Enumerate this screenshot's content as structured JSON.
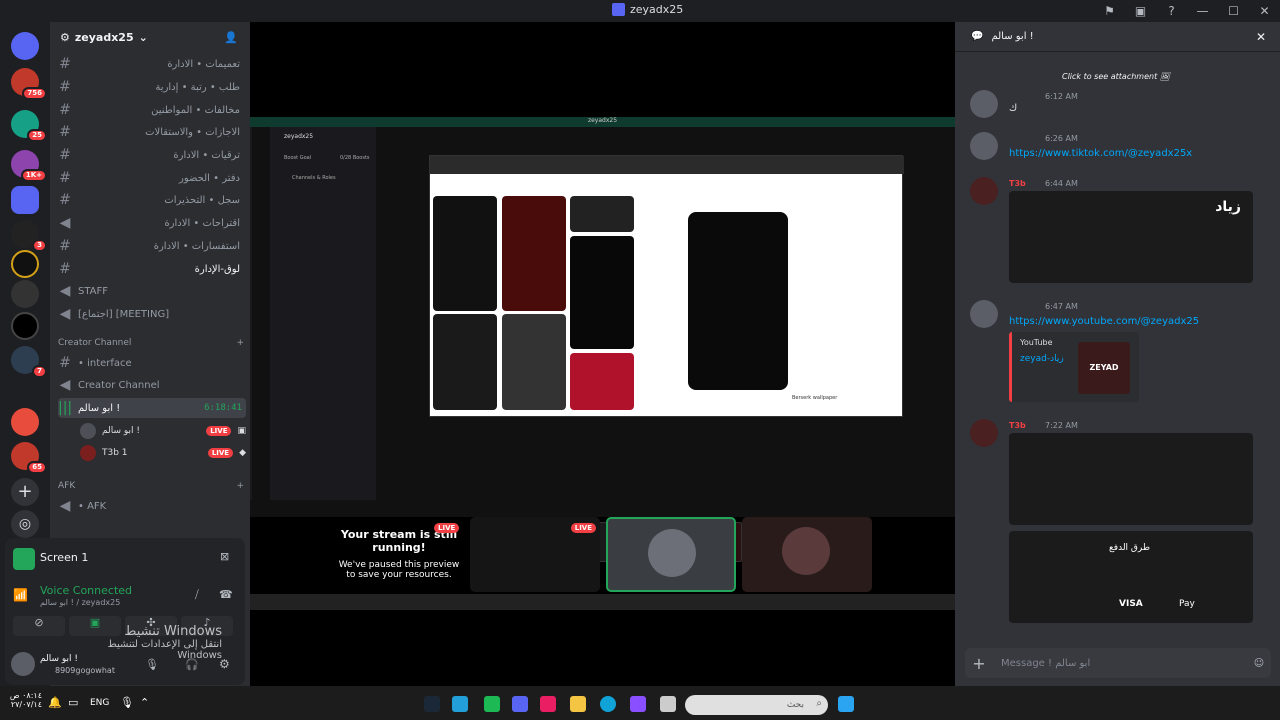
{
  "window": {
    "title": "zeyadx25"
  },
  "rail": {
    "badges": [
      "756",
      "25",
      "1K+",
      "3",
      "7",
      "65"
    ]
  },
  "guild": {
    "name": "zeyadx25"
  },
  "channels": [
    {
      "label": "تعميمات • الادارة",
      "icon": "hash"
    },
    {
      "label": "طلب • رتبة • إدارية",
      "icon": "hash"
    },
    {
      "label": "مخالفات • المواطنين",
      "icon": "hash"
    },
    {
      "label": "الاجازات • والاستقالات",
      "icon": "hash"
    },
    {
      "label": "ترقيات • الادارة",
      "icon": "hash"
    },
    {
      "label": "دفتر • الحضور",
      "icon": "hash"
    },
    {
      "label": "سجل • التحذيرات",
      "icon": "hash"
    },
    {
      "label": "اقتراحات • الادارة",
      "icon": "voice"
    },
    {
      "label": "استفسارات • الادارة",
      "icon": "hash"
    },
    {
      "label": "لوق-الإدارة",
      "icon": "hash"
    },
    {
      "label": "STAFF",
      "icon": "voice"
    },
    {
      "label": "[اجتماع] [MEETING]",
      "icon": "voice"
    }
  ],
  "categories": {
    "creator": "Creator Channel",
    "afk": "AFK"
  },
  "creator_channels": [
    "• interface",
    "Creator Channel"
  ],
  "voice_channel": {
    "name": "ابو سالم !",
    "timer": "6:18:41"
  },
  "voice_users": [
    {
      "name": "ابو سالم !",
      "live": "LIVE"
    },
    {
      "name": "T3b 1",
      "live": "LIVE"
    }
  ],
  "afk_channel": "• AFK",
  "screen": {
    "label": "Screen 1"
  },
  "voice": {
    "status": "Voice Connected",
    "channel": "ابو سالم ! / zeyadx25"
  },
  "user": {
    "name": "ابو سالم !",
    "tag": "8909gogowhat"
  },
  "activation": {
    "title": "تنشيط Windows",
    "sub": "انتقل إلى الإعدادات لتنشيط Windows"
  },
  "stream": {
    "paused_title": "Your stream is still running!",
    "paused_text": "We've paused this preview to save your resources.",
    "live": "LIVE",
    "wallpaper": "Berserk wallpaper",
    "inner_title": "zeyadx25",
    "boost": "Boost Goal",
    "boosts": "0/28 Boosts",
    "roles": "Channels & Roles"
  },
  "panel": {
    "title": "ابو سالم !",
    "composer_placeholder": "Message ! ابو سالم"
  },
  "messages": [
    {
      "attachment": "Click to see attachment",
      "time": "6:12 AM",
      "text": "ك"
    },
    {
      "time": "6:26 AM",
      "text": "https://www.tiktok.com/@zeyadx25x"
    },
    {
      "author": "T3b",
      "time": "6:44 AM",
      "img_title": "زياد"
    },
    {
      "time": "6:47 AM",
      "text": "https://www.youtube.com/@zeyadx25",
      "embed_provider": "YouTube",
      "embed_title": "zeyad-زياد",
      "embed_logo": "ZEYAD"
    },
    {
      "author": "T3b",
      "time": "7:22 AM",
      "img_caption": "طرق الدفع",
      "payments": [
        "VISA",
        "Pay"
      ]
    }
  ],
  "taskbar": {
    "lang": "ENG",
    "time": "٠٨:١٤ ص",
    "date": "٢٧/٠٧/١٤",
    "search": "بحث"
  }
}
